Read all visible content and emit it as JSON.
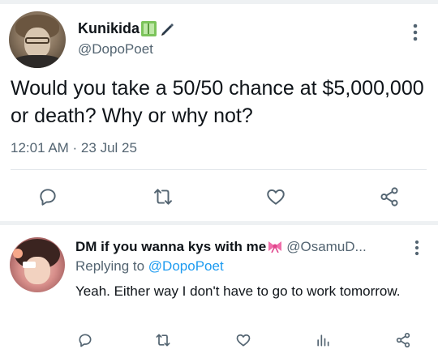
{
  "main_tweet": {
    "display_name": "Kunikida",
    "name_emojis": [
      "green-book-icon",
      "pen-icon"
    ],
    "handle": "@DopoPoet",
    "text": "Would you take a 50/50 chance at $5,000,000 or death? Why or why not?",
    "timestamp": "12:01 AM · 23 Jul 25",
    "actions": [
      "reply-icon",
      "retweet-icon",
      "like-icon",
      "share-icon"
    ]
  },
  "reply": {
    "display_name": "DM if you wanna kys with me",
    "name_emoji": "ribbon-icon",
    "handle": "@OsamuD...",
    "replying_prefix": "Replying to",
    "replying_to": "@DopoPoet",
    "text": "Yeah. Either way I don't have to go to work tomorrow.",
    "actions": [
      "reply-icon",
      "retweet-icon",
      "like-icon",
      "analytics-icon",
      "share-icon"
    ]
  },
  "colors": {
    "text": "#0f1419",
    "secondary": "#536471",
    "link": "#1d9bf0",
    "separator": "#eef1f3"
  }
}
